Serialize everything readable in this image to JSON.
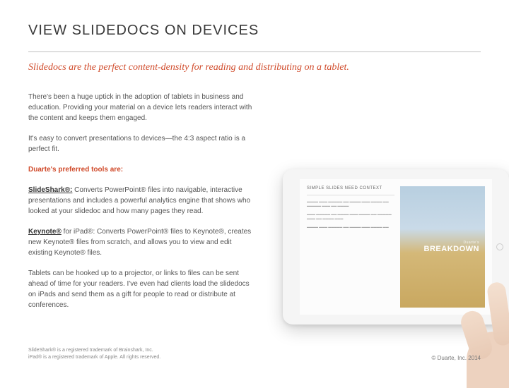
{
  "title": "VIEW SLIDEDOCS ON DEVICES",
  "subtitle": "Slidedocs are the perfect content-density for reading and distributing on a tablet.",
  "body": {
    "p1": "There's been a huge uptick in the adoption of tablets in business and education. Providing your material on a device lets readers interact with the content and keeps them engaged.",
    "p2": "It's easy to convert presentations to devices—the 4:3 aspect ratio is a perfect fit.",
    "tools_label": "Duarte's preferred tools are:",
    "tool1_name": "SlideShark®:",
    "tool1_desc": " Converts PowerPoint® files into navigable, interactive presentations and includes a powerful analytics engine that shows who looked at your slidedoc and how many pages they read.",
    "tool2_name": "Keynote®",
    "tool2_mid": " for iPad®: Converts PowerPoint® files to Keynote®, creates new Keynote® files from scratch, and allows you to view and edit existing Keynote® files.",
    "p5": "Tablets can be hooked up to a projector, or links to files can be sent ahead of time for your readers. I've even had clients load the slidedocs on iPads and send them as a gift for people to read or distribute at conferences."
  },
  "tablet": {
    "heading": "SIMPLE SLIDES NEED CONTEXT",
    "breakdown_small": "Duarte's",
    "breakdown_big": "BREAKDOWN"
  },
  "footnotes": {
    "l1": "SlideShark® is a registered trademark of Brainshark, Inc.",
    "l2": "iPad® is a registered trademark of Apple. All rights reserved."
  },
  "copyright": "© Duarte, Inc. 2014"
}
